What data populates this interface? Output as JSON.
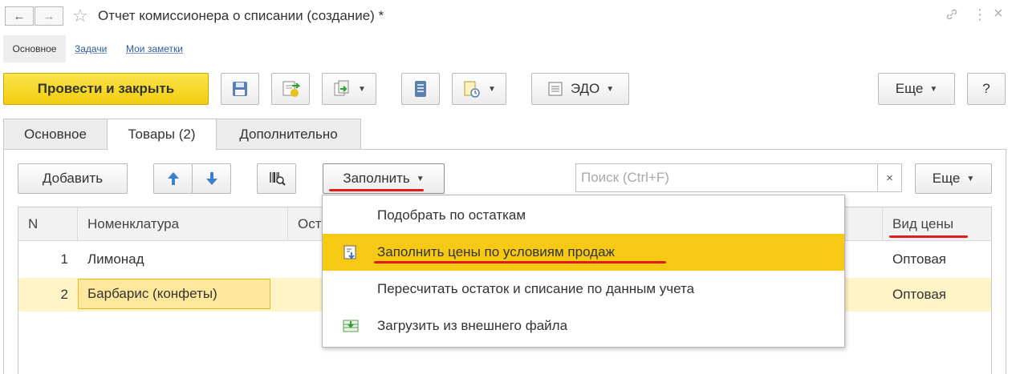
{
  "window": {
    "title": "Отчет комиссионера о списании (создание) *",
    "back_glyph": "←",
    "forward_glyph": "→",
    "star_glyph": "☆",
    "link_glyph": "🔗",
    "more_glyph": "⋮",
    "close_glyph": "×"
  },
  "subnav": {
    "main": "Основное",
    "tasks": "Задачи",
    "notes": "Мои заметки"
  },
  "toolbar": {
    "post_close": "Провести и закрыть",
    "edo": "ЭДО",
    "more": "Еще",
    "help": "?"
  },
  "tabs": [
    {
      "label": "Основное"
    },
    {
      "label": "Товары (2)"
    },
    {
      "label": "Дополнительно"
    }
  ],
  "goods_toolbar": {
    "add": "Добавить",
    "fill": "Заполнить",
    "search_placeholder": "Поиск (Ctrl+F)",
    "search_clear": "×",
    "more": "Еще"
  },
  "table": {
    "columns": [
      "N",
      "Номенклатура",
      "Ост",
      "Вид цены"
    ],
    "rows": [
      {
        "n": "1",
        "name": "Лимонад",
        "price_type": "Оптовая"
      },
      {
        "n": "2",
        "name": "Барбарис (конфеты)",
        "price_type": "Оптовая"
      }
    ]
  },
  "fill_menu": {
    "items": [
      {
        "label": "Подобрать по остаткам",
        "icon": "none"
      },
      {
        "label": "Заполнить цены по условиям продаж",
        "icon": "fill-prices-icon"
      },
      {
        "label": "Пересчитать остаток и списание по данным учета",
        "icon": "none"
      },
      {
        "label": "Загрузить из внешнего файла",
        "icon": "import-file-icon"
      }
    ]
  },
  "colors": {
    "primary_button": "#f2cc0f",
    "menu_highlight": "#f6c914",
    "selected_row": "#fff4c5",
    "red_underline": "#e01b1b",
    "link": "#2c5aa0"
  }
}
